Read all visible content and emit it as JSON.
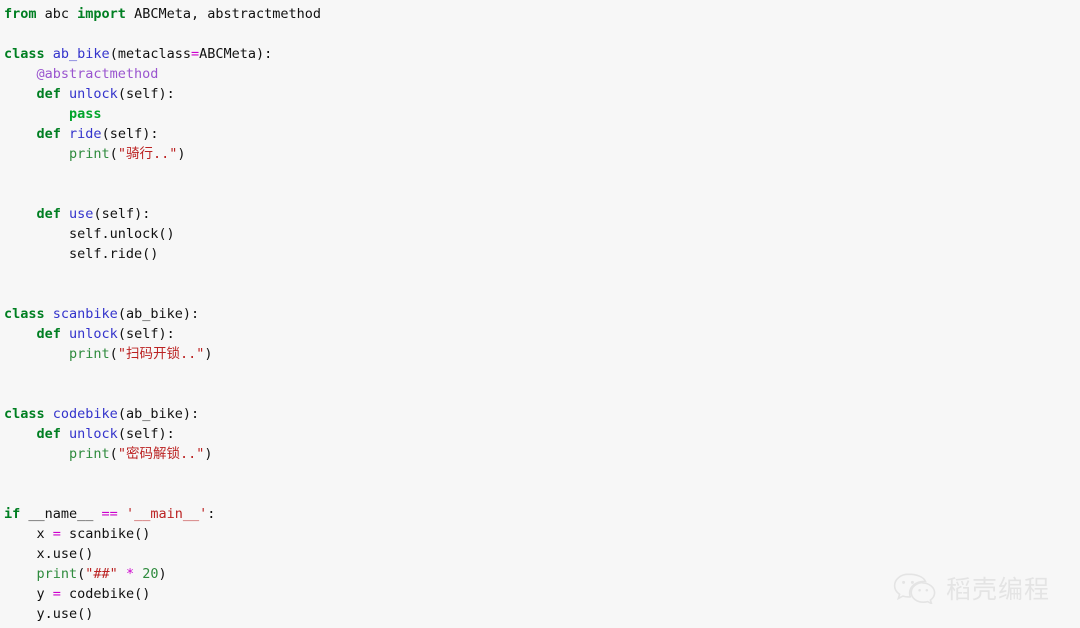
{
  "editor": {
    "background_color": "#f7f7f7",
    "language": "Python",
    "colors": {
      "keyword": "#007f22",
      "pass_keyword": "#00a52b",
      "definition_name": "#3333cc",
      "decorator": "#9a55cf",
      "string": "#bb2222",
      "builtin_function": "#2e8b3d",
      "number": "#2e8b3d",
      "operator": "#cc00cc",
      "plain_text": "#111111"
    }
  },
  "code": {
    "lines": [
      {
        "n": 1,
        "tokens": [
          {
            "t": "from",
            "c": "kw"
          },
          {
            "t": " abc ",
            "c": "plain"
          },
          {
            "t": "import",
            "c": "kw"
          },
          {
            "t": " ABCMeta, abstractmethod",
            "c": "plain"
          }
        ]
      },
      {
        "n": 2,
        "tokens": []
      },
      {
        "n": 3,
        "tokens": [
          {
            "t": "class",
            "c": "kw"
          },
          {
            "t": " ",
            "c": "plain"
          },
          {
            "t": "ab_bike",
            "c": "name"
          },
          {
            "t": "(metaclass",
            "c": "plain"
          },
          {
            "t": "=",
            "c": "op"
          },
          {
            "t": "ABCMeta):",
            "c": "plain"
          }
        ]
      },
      {
        "n": 4,
        "tokens": [
          {
            "t": "    ",
            "c": "plain"
          },
          {
            "t": "@abstractmethod",
            "c": "deco"
          }
        ]
      },
      {
        "n": 5,
        "tokens": [
          {
            "t": "    ",
            "c": "plain"
          },
          {
            "t": "def",
            "c": "kw"
          },
          {
            "t": " ",
            "c": "plain"
          },
          {
            "t": "unlock",
            "c": "name"
          },
          {
            "t": "(self):",
            "c": "plain"
          }
        ]
      },
      {
        "n": 6,
        "tokens": [
          {
            "t": "        ",
            "c": "plain"
          },
          {
            "t": "pass",
            "c": "pass"
          }
        ]
      },
      {
        "n": 7,
        "tokens": [
          {
            "t": "    ",
            "c": "plain"
          },
          {
            "t": "def",
            "c": "kw"
          },
          {
            "t": " ",
            "c": "plain"
          },
          {
            "t": "ride",
            "c": "name"
          },
          {
            "t": "(self):",
            "c": "plain"
          }
        ]
      },
      {
        "n": 8,
        "tokens": [
          {
            "t": "        ",
            "c": "plain"
          },
          {
            "t": "print",
            "c": "fn"
          },
          {
            "t": "(",
            "c": "plain"
          },
          {
            "t": "\"骑行..\"",
            "c": "str"
          },
          {
            "t": ")",
            "c": "plain"
          }
        ]
      },
      {
        "n": 9,
        "tokens": []
      },
      {
        "n": 10,
        "tokens": []
      },
      {
        "n": 11,
        "tokens": [
          {
            "t": "    ",
            "c": "plain"
          },
          {
            "t": "def",
            "c": "kw"
          },
          {
            "t": " ",
            "c": "plain"
          },
          {
            "t": "use",
            "c": "name"
          },
          {
            "t": "(self):",
            "c": "plain"
          }
        ]
      },
      {
        "n": 12,
        "tokens": [
          {
            "t": "        self.unlock()",
            "c": "plain"
          }
        ]
      },
      {
        "n": 13,
        "tokens": [
          {
            "t": "        self.ride()",
            "c": "plain"
          }
        ]
      },
      {
        "n": 14,
        "tokens": []
      },
      {
        "n": 15,
        "tokens": []
      },
      {
        "n": 16,
        "tokens": [
          {
            "t": "class",
            "c": "kw"
          },
          {
            "t": " ",
            "c": "plain"
          },
          {
            "t": "scanbike",
            "c": "name"
          },
          {
            "t": "(ab_bike):",
            "c": "plain"
          }
        ]
      },
      {
        "n": 17,
        "tokens": [
          {
            "t": "    ",
            "c": "plain"
          },
          {
            "t": "def",
            "c": "kw"
          },
          {
            "t": " ",
            "c": "plain"
          },
          {
            "t": "unlock",
            "c": "name"
          },
          {
            "t": "(self):",
            "c": "plain"
          }
        ]
      },
      {
        "n": 18,
        "tokens": [
          {
            "t": "        ",
            "c": "plain"
          },
          {
            "t": "print",
            "c": "fn"
          },
          {
            "t": "(",
            "c": "plain"
          },
          {
            "t": "\"扫码开锁..\"",
            "c": "str"
          },
          {
            "t": ")",
            "c": "plain"
          }
        ]
      },
      {
        "n": 19,
        "tokens": []
      },
      {
        "n": 20,
        "tokens": []
      },
      {
        "n": 21,
        "tokens": [
          {
            "t": "class",
            "c": "kw"
          },
          {
            "t": " ",
            "c": "plain"
          },
          {
            "t": "codebike",
            "c": "name"
          },
          {
            "t": "(ab_bike):",
            "c": "plain"
          }
        ]
      },
      {
        "n": 22,
        "tokens": [
          {
            "t": "    ",
            "c": "plain"
          },
          {
            "t": "def",
            "c": "kw"
          },
          {
            "t": " ",
            "c": "plain"
          },
          {
            "t": "unlock",
            "c": "name"
          },
          {
            "t": "(self):",
            "c": "plain"
          }
        ]
      },
      {
        "n": 23,
        "tokens": [
          {
            "t": "        ",
            "c": "plain"
          },
          {
            "t": "print",
            "c": "fn"
          },
          {
            "t": "(",
            "c": "plain"
          },
          {
            "t": "\"密码解锁..\"",
            "c": "str"
          },
          {
            "t": ")",
            "c": "plain"
          }
        ]
      },
      {
        "n": 24,
        "tokens": []
      },
      {
        "n": 25,
        "tokens": []
      },
      {
        "n": 26,
        "tokens": [
          {
            "t": "if",
            "c": "kw"
          },
          {
            "t": " __name__ ",
            "c": "magic"
          },
          {
            "t": "==",
            "c": "op"
          },
          {
            "t": " ",
            "c": "plain"
          },
          {
            "t": "'__main__'",
            "c": "str"
          },
          {
            "t": ":",
            "c": "plain"
          }
        ]
      },
      {
        "n": 27,
        "tokens": [
          {
            "t": "    x ",
            "c": "plain"
          },
          {
            "t": "=",
            "c": "op"
          },
          {
            "t": " scanbike()",
            "c": "plain"
          }
        ]
      },
      {
        "n": 28,
        "tokens": [
          {
            "t": "    x.use()",
            "c": "plain"
          }
        ]
      },
      {
        "n": 29,
        "tokens": [
          {
            "t": "    ",
            "c": "plain"
          },
          {
            "t": "print",
            "c": "fn"
          },
          {
            "t": "(",
            "c": "plain"
          },
          {
            "t": "\"##\"",
            "c": "str"
          },
          {
            "t": " ",
            "c": "plain"
          },
          {
            "t": "*",
            "c": "op"
          },
          {
            "t": " ",
            "c": "plain"
          },
          {
            "t": "20",
            "c": "num"
          },
          {
            "t": ")",
            "c": "plain"
          }
        ]
      },
      {
        "n": 30,
        "tokens": [
          {
            "t": "    y ",
            "c": "plain"
          },
          {
            "t": "=",
            "c": "op"
          },
          {
            "t": " codebike()",
            "c": "plain"
          }
        ]
      },
      {
        "n": 31,
        "tokens": [
          {
            "t": "    y.use()",
            "c": "plain"
          }
        ]
      }
    ]
  },
  "watermark": {
    "text": "稻壳编程",
    "icon": "wechat-logo-icon",
    "color": "#b9b9b9"
  }
}
